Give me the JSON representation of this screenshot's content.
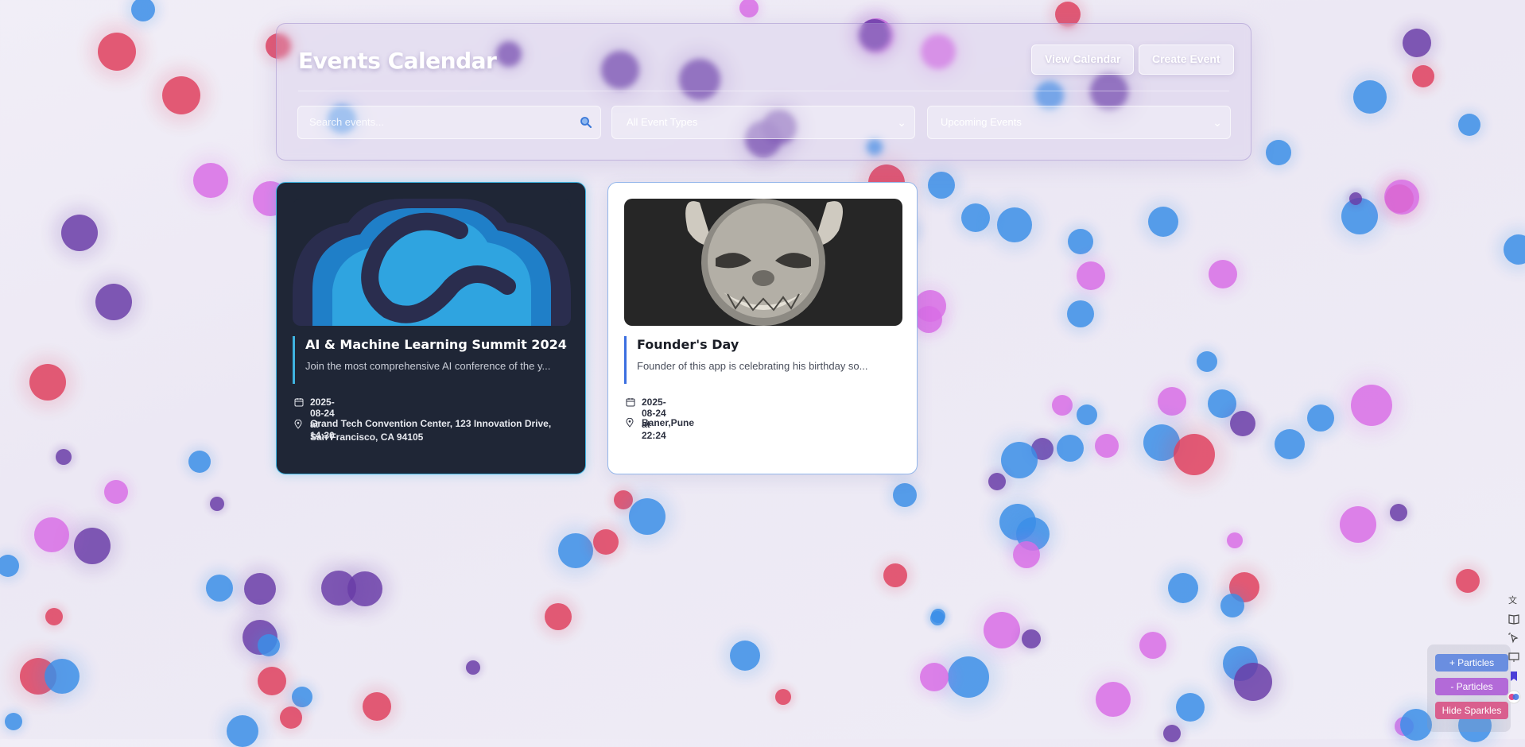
{
  "header": {
    "title": "Events Calendar",
    "view_calendar_label": "View Calendar",
    "create_event_label": "Create Event",
    "search_placeholder": "Search events...",
    "type_filter_value": "All Event Types",
    "time_filter_value": "Upcoming Events"
  },
  "events": [
    {
      "title": "AI & Machine Learning Summit 2024",
      "description": "Join the most comprehensive AI conference of the y...",
      "datetime": "2025-08-24 at 14:30",
      "location": "Grand Tech Convention Center, 123 Innovation Drive, San Francisco, CA 94105",
      "image_icon": "cloud-logo-icon",
      "accent_color": "#3fb3e0"
    },
    {
      "title": "Founder's Day",
      "description": "Founder of this app is celebrating his birthday so...",
      "datetime": "2025-08-24 at 22:24",
      "location": "Baner,Pune",
      "image_icon": "oni-mask-icon",
      "accent_color": "#3b6fe0"
    }
  ],
  "controls": {
    "add_particles_label": "+ Particles",
    "remove_particles_label": "- Particles",
    "hide_sparkles_label": "Hide Sparkles"
  },
  "colors": {
    "particle_red": "#e0405e",
    "particle_blue": "#3b8fe8",
    "particle_purple": "#6a3da8",
    "particle_pink": "#d96ee6",
    "btn_blue": "#6a8ee0",
    "btn_purple": "#b36ad8",
    "btn_pink": "#d95f8e"
  }
}
